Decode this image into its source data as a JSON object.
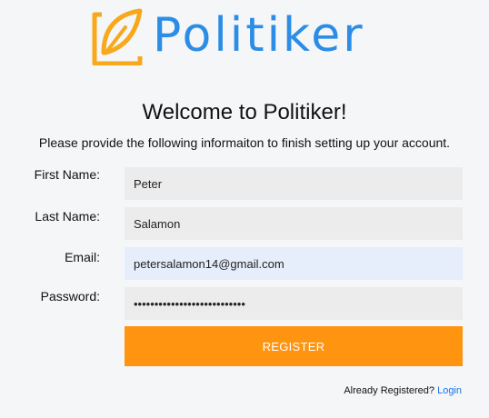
{
  "brand": {
    "name": "Politiker",
    "logo_icon": "feather-bookmark-icon",
    "logo_color": "#f7a81b",
    "text_color": "#2b8de6"
  },
  "heading": "Welcome to Politiker!",
  "subtitle": "Please provide the following informaiton to finish setting up your account.",
  "form": {
    "first_name": {
      "label": "First Name:",
      "value": "Peter"
    },
    "last_name": {
      "label": "Last Name:",
      "value": "Salamon"
    },
    "email": {
      "label": "Email:",
      "value": "petersalamon14@gmail.com"
    },
    "password": {
      "label": "Password:",
      "value": "xxxxxxxxxxxxxxxxxxxxxxxxxxx"
    },
    "submit_label": "REGISTER"
  },
  "footer": {
    "prompt": "Already Registered?",
    "link_label": "Login"
  },
  "colors": {
    "accent": "#ff9411",
    "background": "#f5f6f8",
    "input_bg": "#ececec",
    "autofill_bg": "#e6edfb",
    "link": "#1a73e8"
  }
}
